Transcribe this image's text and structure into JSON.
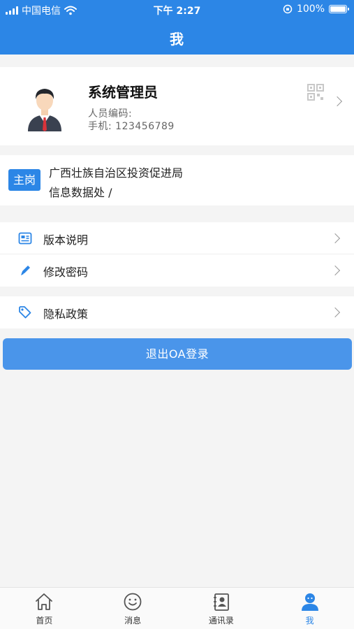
{
  "status_bar": {
    "carrier": "中国电信",
    "time": "下午 2:27",
    "battery": "100%"
  },
  "header": {
    "title": "我"
  },
  "profile": {
    "name": "系统管理员",
    "employee_id_label": "人员编码:",
    "phone_label": "手机:",
    "phone": "123456789"
  },
  "department": {
    "badge": "主岗",
    "org": "广西壮族自治区投资促进局",
    "division": "信息数据处 /"
  },
  "menu": {
    "version": "版本说明",
    "password": "修改密码",
    "privacy": "隐私政策"
  },
  "logout": {
    "label": "退出OA登录"
  },
  "tabbar": {
    "home": "首页",
    "messages": "消息",
    "contacts": "通讯录",
    "me": "我"
  },
  "colors": {
    "accent": "#2c86e6",
    "button": "#4a95ea",
    "background": "#f4f4f4"
  }
}
